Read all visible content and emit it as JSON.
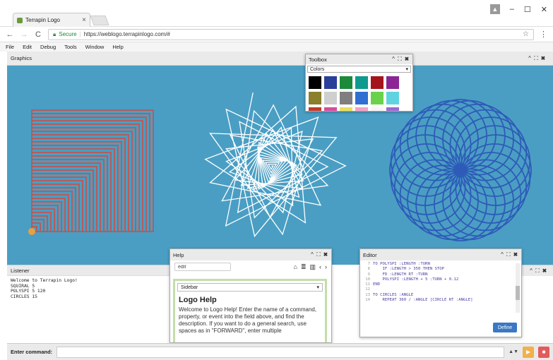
{
  "browser": {
    "tab_title": "Terrapin Logo",
    "tab_close": "×",
    "back": "←",
    "forward": "→",
    "reload": "C",
    "secure_label": "Secure",
    "url": "https://weblogo.terrapinlogo.com/#",
    "bookmark": "☆",
    "menu": "⋮",
    "win_user": "▲",
    "win_min": "–",
    "win_max": "☐",
    "win_close": "✕"
  },
  "menubar": {
    "items": [
      "File",
      "Edit",
      "Debug",
      "Tools",
      "Window",
      "Help"
    ]
  },
  "graphics": {
    "title": "Graphics",
    "controls": "^ ⛶ ✖"
  },
  "canvas": {
    "background": "#4a9ec3",
    "squiral_color": "#d9473b",
    "polyspi_color": "#ffffff",
    "circles_color": "#2e5bb8"
  },
  "toolbox": {
    "title": "Toolbox",
    "controls": "^ ⛶ ✖",
    "selector": "Colors",
    "selector_arrow": "▾",
    "swatches": [
      "#000000",
      "#2a3f9a",
      "#1b8a3a",
      "#0e9a8f",
      "#a3151a",
      "#8b2596",
      "#8a7f2a",
      "#cfcfcf",
      "#7f7f7f",
      "#2f6fd2",
      "#6ad24a",
      "#5fd4e0",
      "#c0392b",
      "#d94aa0",
      "#e8e05a",
      "#f2a0c8",
      "#f5f5f5",
      "#9a6ad2"
    ]
  },
  "listener": {
    "title": "Listener",
    "controls": "^ ⛶ ✖",
    "lines": [
      "Welcome to Terrapin Logo!",
      "SQUIRAL 5",
      "POLYSPI 5 120",
      "CIRCLES 15"
    ]
  },
  "help": {
    "title": "Help",
    "controls": "^ ⛶ ✖",
    "search_value": "edit",
    "icons": [
      "⌂",
      "≣",
      "▥",
      "‹",
      "›"
    ],
    "sidebar_label": "Sidebar",
    "sidebar_arrow": "▾",
    "heading": "Logo Help",
    "text": "Welcome to Logo Help! Enter the name of a command, property, or event into the field above, and find the description. If you want to do a general search, use spaces as in \"FORWARD\", enter multiple"
  },
  "editor": {
    "title": "Editor",
    "controls": "^ ⛶ ✖",
    "lines": [
      {
        "n": "7",
        "code": "TO POLYSPI :LENGTH :TURN"
      },
      {
        "n": "8",
        "code": "    IF :LENGTH > 350 THEN STOP"
      },
      {
        "n": "9",
        "code": "    FD :LENGTH RT :TURN"
      },
      {
        "n": "10",
        "code": "    POLYSPI :LENGTH + 5 :TURN + 0.12"
      },
      {
        "n": "11",
        "code": "END"
      },
      {
        "n": "12",
        "code": ""
      },
      {
        "n": "13",
        "code": "TO CIRCLES :ANGLE"
      },
      {
        "n": "14",
        "code": "    REPEAT 360 / :ANGLE [CIRCLE RT :ANGLE]"
      }
    ],
    "define_label": "Define"
  },
  "commandbar": {
    "label": "Enter command:",
    "stepper": "▲▼",
    "run_icon": "▶",
    "stop_icon": "■"
  }
}
